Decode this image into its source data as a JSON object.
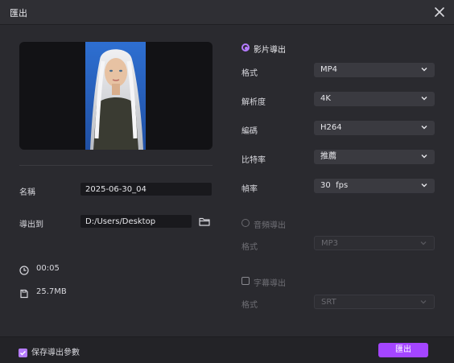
{
  "window": {
    "title": "匯出"
  },
  "left": {
    "name_label": "名稱",
    "name_value": "2025-06-30_04",
    "export_to_label": "導出到",
    "export_path": "D:/Users/Desktop",
    "duration": "00:05",
    "filesize": "25.7MB"
  },
  "video_export": {
    "label": "影片導出",
    "format": {
      "label": "格式",
      "value": "MP4"
    },
    "resolution": {
      "label": "解析度",
      "value": "4K"
    },
    "codec": {
      "label": "編碼",
      "value": "H264"
    },
    "bitrate": {
      "label": "比特率",
      "value": "推薦"
    },
    "fps": {
      "label": "幀率",
      "value": "30  fps"
    }
  },
  "audio_export": {
    "label": "音頻導出",
    "format": {
      "label": "格式",
      "value": "MP3"
    }
  },
  "subtitle_export": {
    "label": "字幕導出",
    "format": {
      "label": "格式",
      "value": "SRT"
    }
  },
  "footer": {
    "save_params_label": "保存導出參數",
    "export_button": "匯出"
  },
  "icons": {
    "close": "close-icon",
    "folder": "folder-icon",
    "clock": "clock-icon",
    "file": "file-icon",
    "chevron": "chevron-down-icon",
    "checkbox": "checkbox-checked-icon"
  },
  "colors": {
    "accent": "#a445ff",
    "radio": "#b57cff"
  }
}
